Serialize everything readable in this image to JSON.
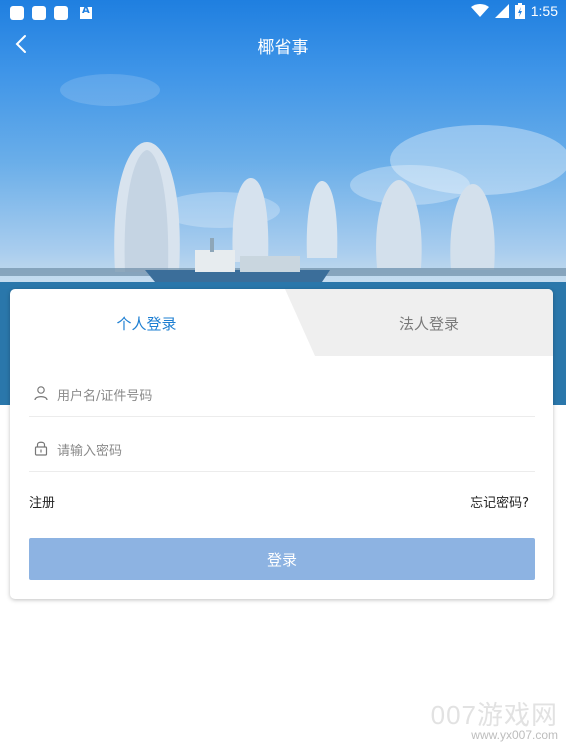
{
  "status_bar": {
    "time": "1:55"
  },
  "header": {
    "title": "椰省事"
  },
  "tabs": [
    {
      "label": "个人登录",
      "active": true
    },
    {
      "label": "法人登录",
      "active": false
    }
  ],
  "form": {
    "username_placeholder": "用户名/证件号码",
    "password_placeholder": "请输入密码",
    "register_label": "注册",
    "forgot_label": "忘记密码?",
    "login_label": "登录"
  },
  "watermark": {
    "brand": "007游戏网",
    "url": "www.yx007.com"
  },
  "colors": {
    "accent": "#1e7fd2",
    "login_button": "#8db3e2",
    "sky": "#1f7fe0"
  }
}
